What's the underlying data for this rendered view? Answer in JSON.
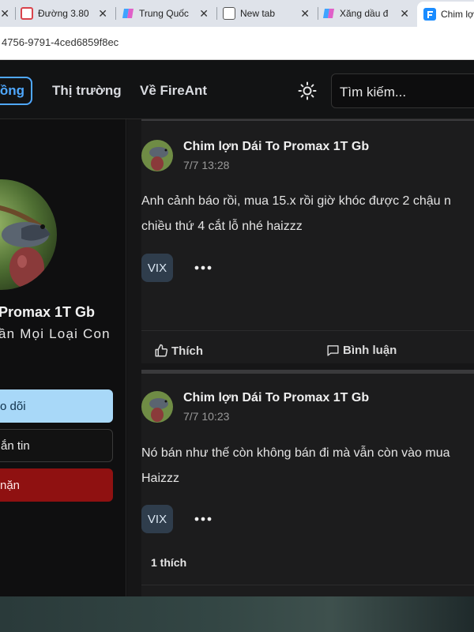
{
  "browser": {
    "tabs": [
      {
        "title": "Đường 3.80",
        "icon": "document-icon",
        "color": "#d9434b"
      },
      {
        "title": "Trung Quốc",
        "icon": "copilot-icon",
        "color": "#7b5cff"
      },
      {
        "title": "New tab",
        "icon": "new-tab-icon",
        "color": "#555555"
      },
      {
        "title": "Xăng dầu đ",
        "icon": "copilot-icon",
        "color": "#7b5cff"
      },
      {
        "title": "Chim lợ",
        "icon": "fireant-icon",
        "color": "#1a8cff"
      }
    ],
    "url": "4756-9791-4ced6859f8ec"
  },
  "header": {
    "nav_active": "đồng",
    "nav_items": [
      "Thị trường",
      "Về FireAnt"
    ],
    "search_placeholder": "Tìm kiếm...",
    "theme_icon": "sun-icon",
    "accent": "#4fa8ff"
  },
  "profile": {
    "name": "Promax 1T Gb",
    "bio": "ần Mọi Loại Con",
    "buttons": {
      "follow": "o dõi",
      "message": "ắn tin",
      "block": "nặn"
    },
    "colors": {
      "follow": "#a8d8f8",
      "block": "#8f1111"
    }
  },
  "posts": [
    {
      "author": "Chim lợn Dái To Promax 1T Gb",
      "time": "7/7 13:28",
      "lines": [
        "Anh cảnh báo rồi, mua 15.x rồi giờ khóc được 2 chậu n",
        "chiều thứ 4 cắt lỗ nhé haizzz"
      ],
      "tag": "VIX",
      "actions": {
        "like": "Thích",
        "comment": "Bình luận"
      }
    },
    {
      "author": "Chim lợn Dái To Promax 1T Gb",
      "time": "7/7 10:23",
      "lines": [
        "Nó bán như thế còn không bán đi mà vẫn còn vào mua",
        "Haizzz"
      ],
      "tag": "VIX",
      "likes": "1 thích"
    }
  ]
}
